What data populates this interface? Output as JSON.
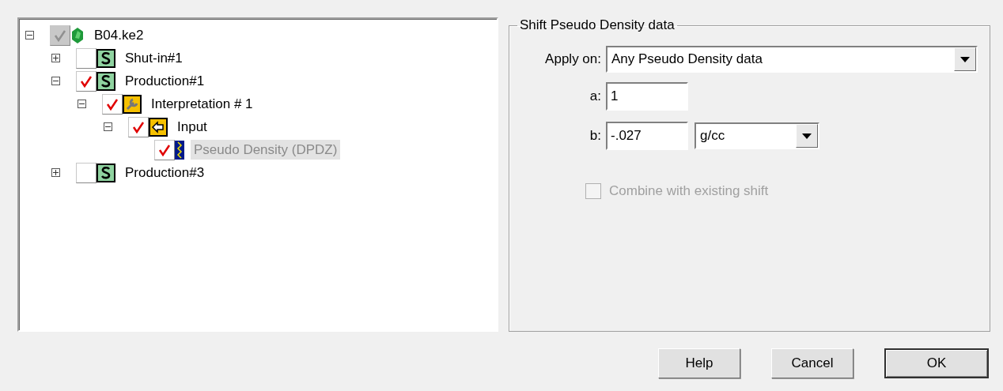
{
  "tree": [
    {
      "label": "B04.ke2",
      "kind": "project",
      "expanded": true,
      "checked": true,
      "greyed": true,
      "selected": false,
      "children": [
        {
          "label": "Shut-in#1",
          "kind": "session",
          "expanded": false,
          "checked": false,
          "selected": false
        },
        {
          "label": "Production#1",
          "kind": "session",
          "expanded": true,
          "checked": true,
          "selected": false,
          "children": [
            {
              "label": "Interpretation # 1",
              "kind": "interpretation",
              "expanded": true,
              "checked": true,
              "selected": false,
              "children": [
                {
                  "label": "Input",
                  "kind": "input",
                  "expanded": true,
                  "checked": true,
                  "selected": false,
                  "children": [
                    {
                      "label": "Pseudo Density (DPDZ)",
                      "kind": "data",
                      "checked": true,
                      "selected": true
                    }
                  ]
                }
              ]
            }
          ]
        },
        {
          "label": "Production#3",
          "kind": "session",
          "expanded": false,
          "checked": false,
          "selected": false
        }
      ]
    }
  ],
  "group": {
    "title": "Shift Pseudo Density data",
    "apply_on": {
      "label": "Apply on:",
      "value": "Any Pseudo Density data"
    },
    "a": {
      "label": "a:",
      "value": "1"
    },
    "b": {
      "label": "b:",
      "value": "-.027",
      "unit": "g/cc"
    },
    "combine": {
      "label": "Combine with existing shift",
      "checked": false,
      "disabled": true
    }
  },
  "buttons": [
    {
      "label": "Help",
      "default": false
    },
    {
      "label": "Cancel",
      "default": false
    },
    {
      "label": "OK",
      "default": true
    }
  ]
}
